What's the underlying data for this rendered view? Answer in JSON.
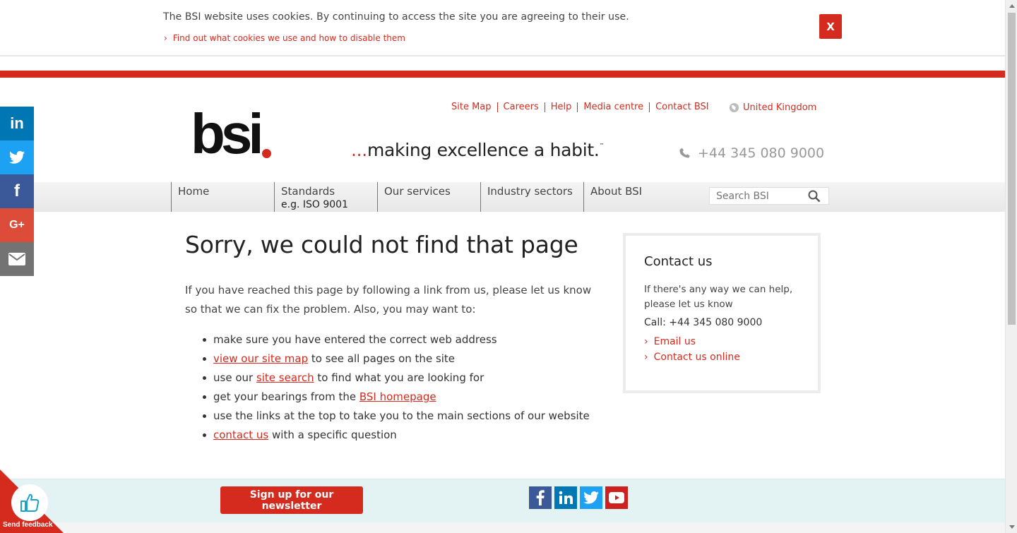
{
  "cookie_bar": {
    "message": "The BSI website uses cookies. By continuing to access the site you are agreeing to their use.",
    "link_chevron": "›",
    "link_label": "Find out what cookies we use and how to disable them",
    "close_label": "X"
  },
  "social_side": {
    "items": [
      {
        "icon": "linkedin-icon",
        "label": "in"
      },
      {
        "icon": "twitter-icon",
        "label": ""
      },
      {
        "icon": "facebook-icon",
        "label": "f"
      },
      {
        "icon": "google-plus-icon",
        "label": "G+"
      },
      {
        "icon": "email-icon",
        "label": ""
      }
    ]
  },
  "header": {
    "logo_text": "bsi",
    "util_nav": [
      "Site Map",
      "Careers",
      "Help",
      "Media centre",
      "Contact BSI"
    ],
    "region": "United Kingdom",
    "tagline_dots": "...",
    "tagline": "making excellence a habit.",
    "tagline_tm": "™",
    "phone": "+44 345 080 9000"
  },
  "main_nav": {
    "items": [
      {
        "label": "Home",
        "sub": ""
      },
      {
        "label": "Standards",
        "sub": "e.g. ISO 9001"
      },
      {
        "label": "Our services",
        "sub": ""
      },
      {
        "label": "Industry sectors",
        "sub": ""
      },
      {
        "label": "About BSI",
        "sub": ""
      }
    ],
    "search_placeholder": "Search BSI"
  },
  "content": {
    "title": "Sorry, we could not find that page",
    "intro": "If you have reached this page by following a link from us, please let us know so that we can fix the problem. Also, you may want to:",
    "bullets": [
      {
        "pre": "make sure you have entered the correct web address",
        "link": "",
        "post": ""
      },
      {
        "pre": "",
        "link": "view our site map",
        "post": " to see all pages on the site"
      },
      {
        "pre": "use our ",
        "link": "site search",
        "post": " to find what you are looking for"
      },
      {
        "pre": "get your bearings from the ",
        "link": "BSI homepage",
        "post": ""
      },
      {
        "pre": "use the links at the top to take you to the main sections of our website",
        "link": "",
        "post": ""
      },
      {
        "pre": "",
        "link": "contact us",
        "post": " with a specific question"
      }
    ]
  },
  "contact_box": {
    "title": "Contact us",
    "text": "If there's any way we can help, please let us know",
    "call": "Call: +44 345 080 9000",
    "chevron": "›",
    "links": [
      "Email us",
      "Contact us online"
    ]
  },
  "footer": {
    "newsletter_label": "Sign up for our newsletter",
    "social": [
      "facebook-icon",
      "linkedin-icon",
      "twitter-icon",
      "youtube-icon"
    ]
  },
  "feedback": {
    "label": "Send feedback"
  },
  "colors": {
    "brand_red": "#d52b1e",
    "linkedin": "#0077b5",
    "twitter": "#1da1f2",
    "facebook": "#3b5998",
    "google_plus": "#dd4b39",
    "email": "#737373",
    "youtube": "#cd201f",
    "footer_bg": "#e3f3f3"
  }
}
